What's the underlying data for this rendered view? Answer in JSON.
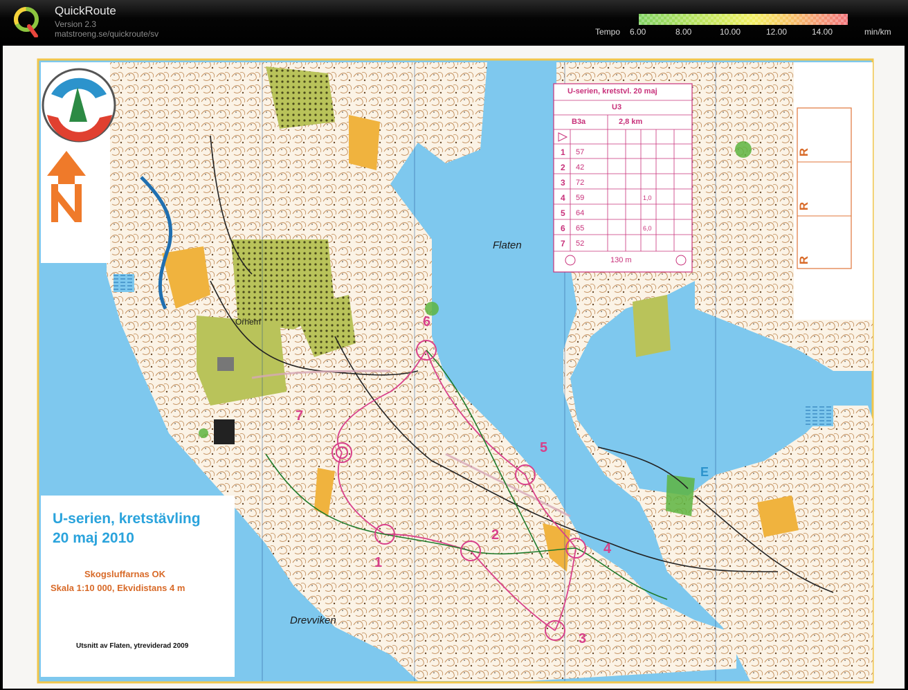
{
  "app": {
    "title": "QuickRoute",
    "version": "Version 2.3",
    "url": "matstroeng.se/quickroute/sv"
  },
  "tempo_scale": {
    "label": "Tempo",
    "ticks": [
      "6.00",
      "8.00",
      "10.00",
      "12.00",
      "14.00"
    ],
    "unit": "min/km",
    "colors": [
      "#7fd161",
      "#d2ea5e",
      "#f3ef62",
      "#f7c465",
      "#f2737a"
    ]
  },
  "map": {
    "place_labels": {
      "flaten": "Flaten",
      "orhem": "Orhem",
      "drevviken": "Drevviken"
    },
    "event_title_line1": "U-serien, kretstävling",
    "event_title_line2": "20 maj 2010",
    "club": "Skogsluffarnas OK",
    "scale_text": "Skala 1:10 000, Ekvidistans 4 m",
    "credit": "Utsnitt av Flaten, ytreviderad 2009",
    "controls": [
      "1",
      "2",
      "3",
      "4",
      "5",
      "6",
      "7"
    ],
    "side_marks": [
      "R",
      "R",
      "R"
    ],
    "east_mark": "E",
    "colors": {
      "water": "#7ec8ee",
      "land": "#fbf3e6",
      "contour": "#c08a55",
      "open": "#f0b33e",
      "course": "#d8408a",
      "green": "#5db43f",
      "border": "#f1c64b"
    }
  },
  "control_card": {
    "header1": "U-serien, kretstvl. 20 maj",
    "header2": "U3",
    "course": "B3a",
    "length": "2,8 km",
    "rows": [
      {
        "num": "1",
        "code": "57",
        "extra": ""
      },
      {
        "num": "2",
        "code": "42",
        "extra": ""
      },
      {
        "num": "3",
        "code": "72",
        "extra": ""
      },
      {
        "num": "4",
        "code": "59",
        "extra": "1,0"
      },
      {
        "num": "5",
        "code": "64",
        "extra": ""
      },
      {
        "num": "6",
        "code": "65",
        "extra": "6,0"
      },
      {
        "num": "7",
        "code": "52",
        "extra": ""
      }
    ],
    "finish": "130 m"
  }
}
